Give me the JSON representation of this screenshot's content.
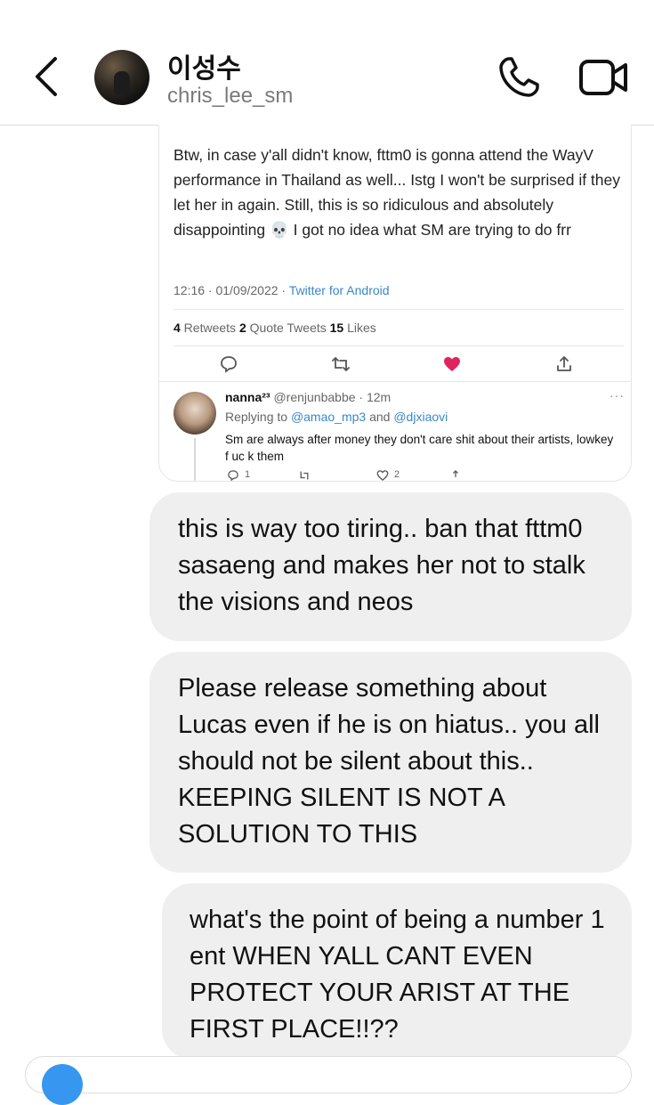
{
  "header": {
    "name": "이성수",
    "username": "chris_lee_sm"
  },
  "tweet": {
    "text": "Btw, in case y'all didn't know, fttm0 is gonna attend the WayV performance in Thailand as well... Istg I won't be surprised if they let her in again. Still, this is so ridiculous and absolutely disappointing 💀 I got no idea what SM are trying to do frr",
    "timestamp": "12:16 · 01/09/2022 · ",
    "source": "Twitter for Android",
    "retweets": "4",
    "retweets_label": " Retweets ",
    "quotes": "2",
    "quotes_label": " Quote Tweets ",
    "likes": "15",
    "likes_label": " Likes",
    "reply": {
      "display_name": "nanna²³",
      "handle_time": " @renjunbabbe · 12m",
      "replying_prefix": "Replying to ",
      "mention1": "@amao_mp3",
      "replying_and": " and ",
      "mention2": "@djxiaovi",
      "text": "Sm are always after money they don't care shit about their artists, lowkey f uc k them",
      "reply_count": "1",
      "like_count": "2"
    }
  },
  "messages": [
    "this is way too tiring.. ban that fttm0 sasaeng and makes her not to stalk the visions and neos",
    "Please release something about Lucas even if he is on hiatus.. you all should not be silent about this.. KEEPING SILENT IS NOT A SOLUTION TO THIS",
    "what's the point of being a number 1 ent WHEN YALL CANT EVEN PROTECT YOUR ARIST AT THE FIRST PLACE!!??"
  ],
  "colors": {
    "bubble": "#efefef",
    "link": "#3a87c8",
    "like": "#e0245e",
    "camera": "#3797f0"
  },
  "icons": [
    "back-icon",
    "phone-icon",
    "video-icon",
    "reply-icon",
    "retweet-icon",
    "heart-icon",
    "share-icon"
  ]
}
